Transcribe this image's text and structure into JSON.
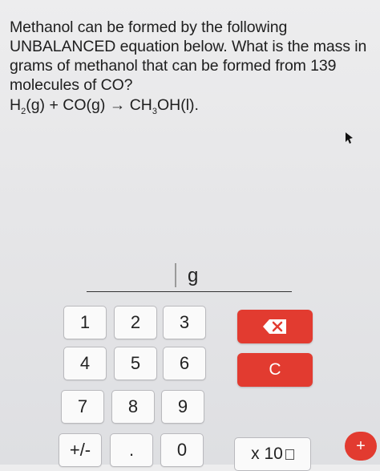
{
  "question": {
    "lines": [
      "Methanol can be formed by the following",
      "UNBALANCED equation below. What is the mass in",
      "grams of methanol that can be formed from 139",
      "molecules of CO?"
    ],
    "equation": {
      "part1": "H",
      "sub1": "2",
      "part2": "(g) + CO(g) → CH",
      "sub2": "3",
      "part3": "OH(l)."
    }
  },
  "answer": {
    "value": "",
    "unit": "g"
  },
  "keypad": {
    "keys": [
      "1",
      "2",
      "3",
      "4",
      "5",
      "6",
      "7",
      "8",
      "9",
      "+/-",
      ".",
      "0"
    ],
    "clear_label": "C",
    "sci_label": "x 10",
    "plus_label": "+"
  },
  "colors": {
    "accent": "#e23b30",
    "background": "#e6e6e8"
  }
}
